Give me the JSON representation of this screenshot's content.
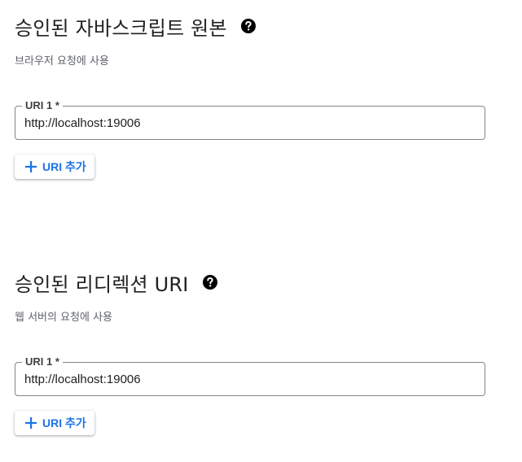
{
  "colors": {
    "accent": "#1a73e8",
    "border": "#80868b",
    "title": "#202124",
    "subtitle": "#5f6368"
  },
  "sections": [
    {
      "title": "승인된 자바스크립트 원본",
      "help_icon": "help-circle-icon",
      "subtitle": "브라우저 요청에 사용",
      "field": {
        "label": "URI 1 *",
        "value": "http://localhost:19006"
      },
      "add_button": {
        "icon": "plus-icon",
        "label": "URI 추가"
      }
    },
    {
      "title": "승인된 리디렉션 URI",
      "help_icon": "help-circle-icon",
      "subtitle": "웹 서버의 요청에 사용",
      "field": {
        "label": "URI 1 *",
        "value": "http://localhost:19006"
      },
      "add_button": {
        "icon": "plus-icon",
        "label": "URI 추가"
      }
    }
  ]
}
